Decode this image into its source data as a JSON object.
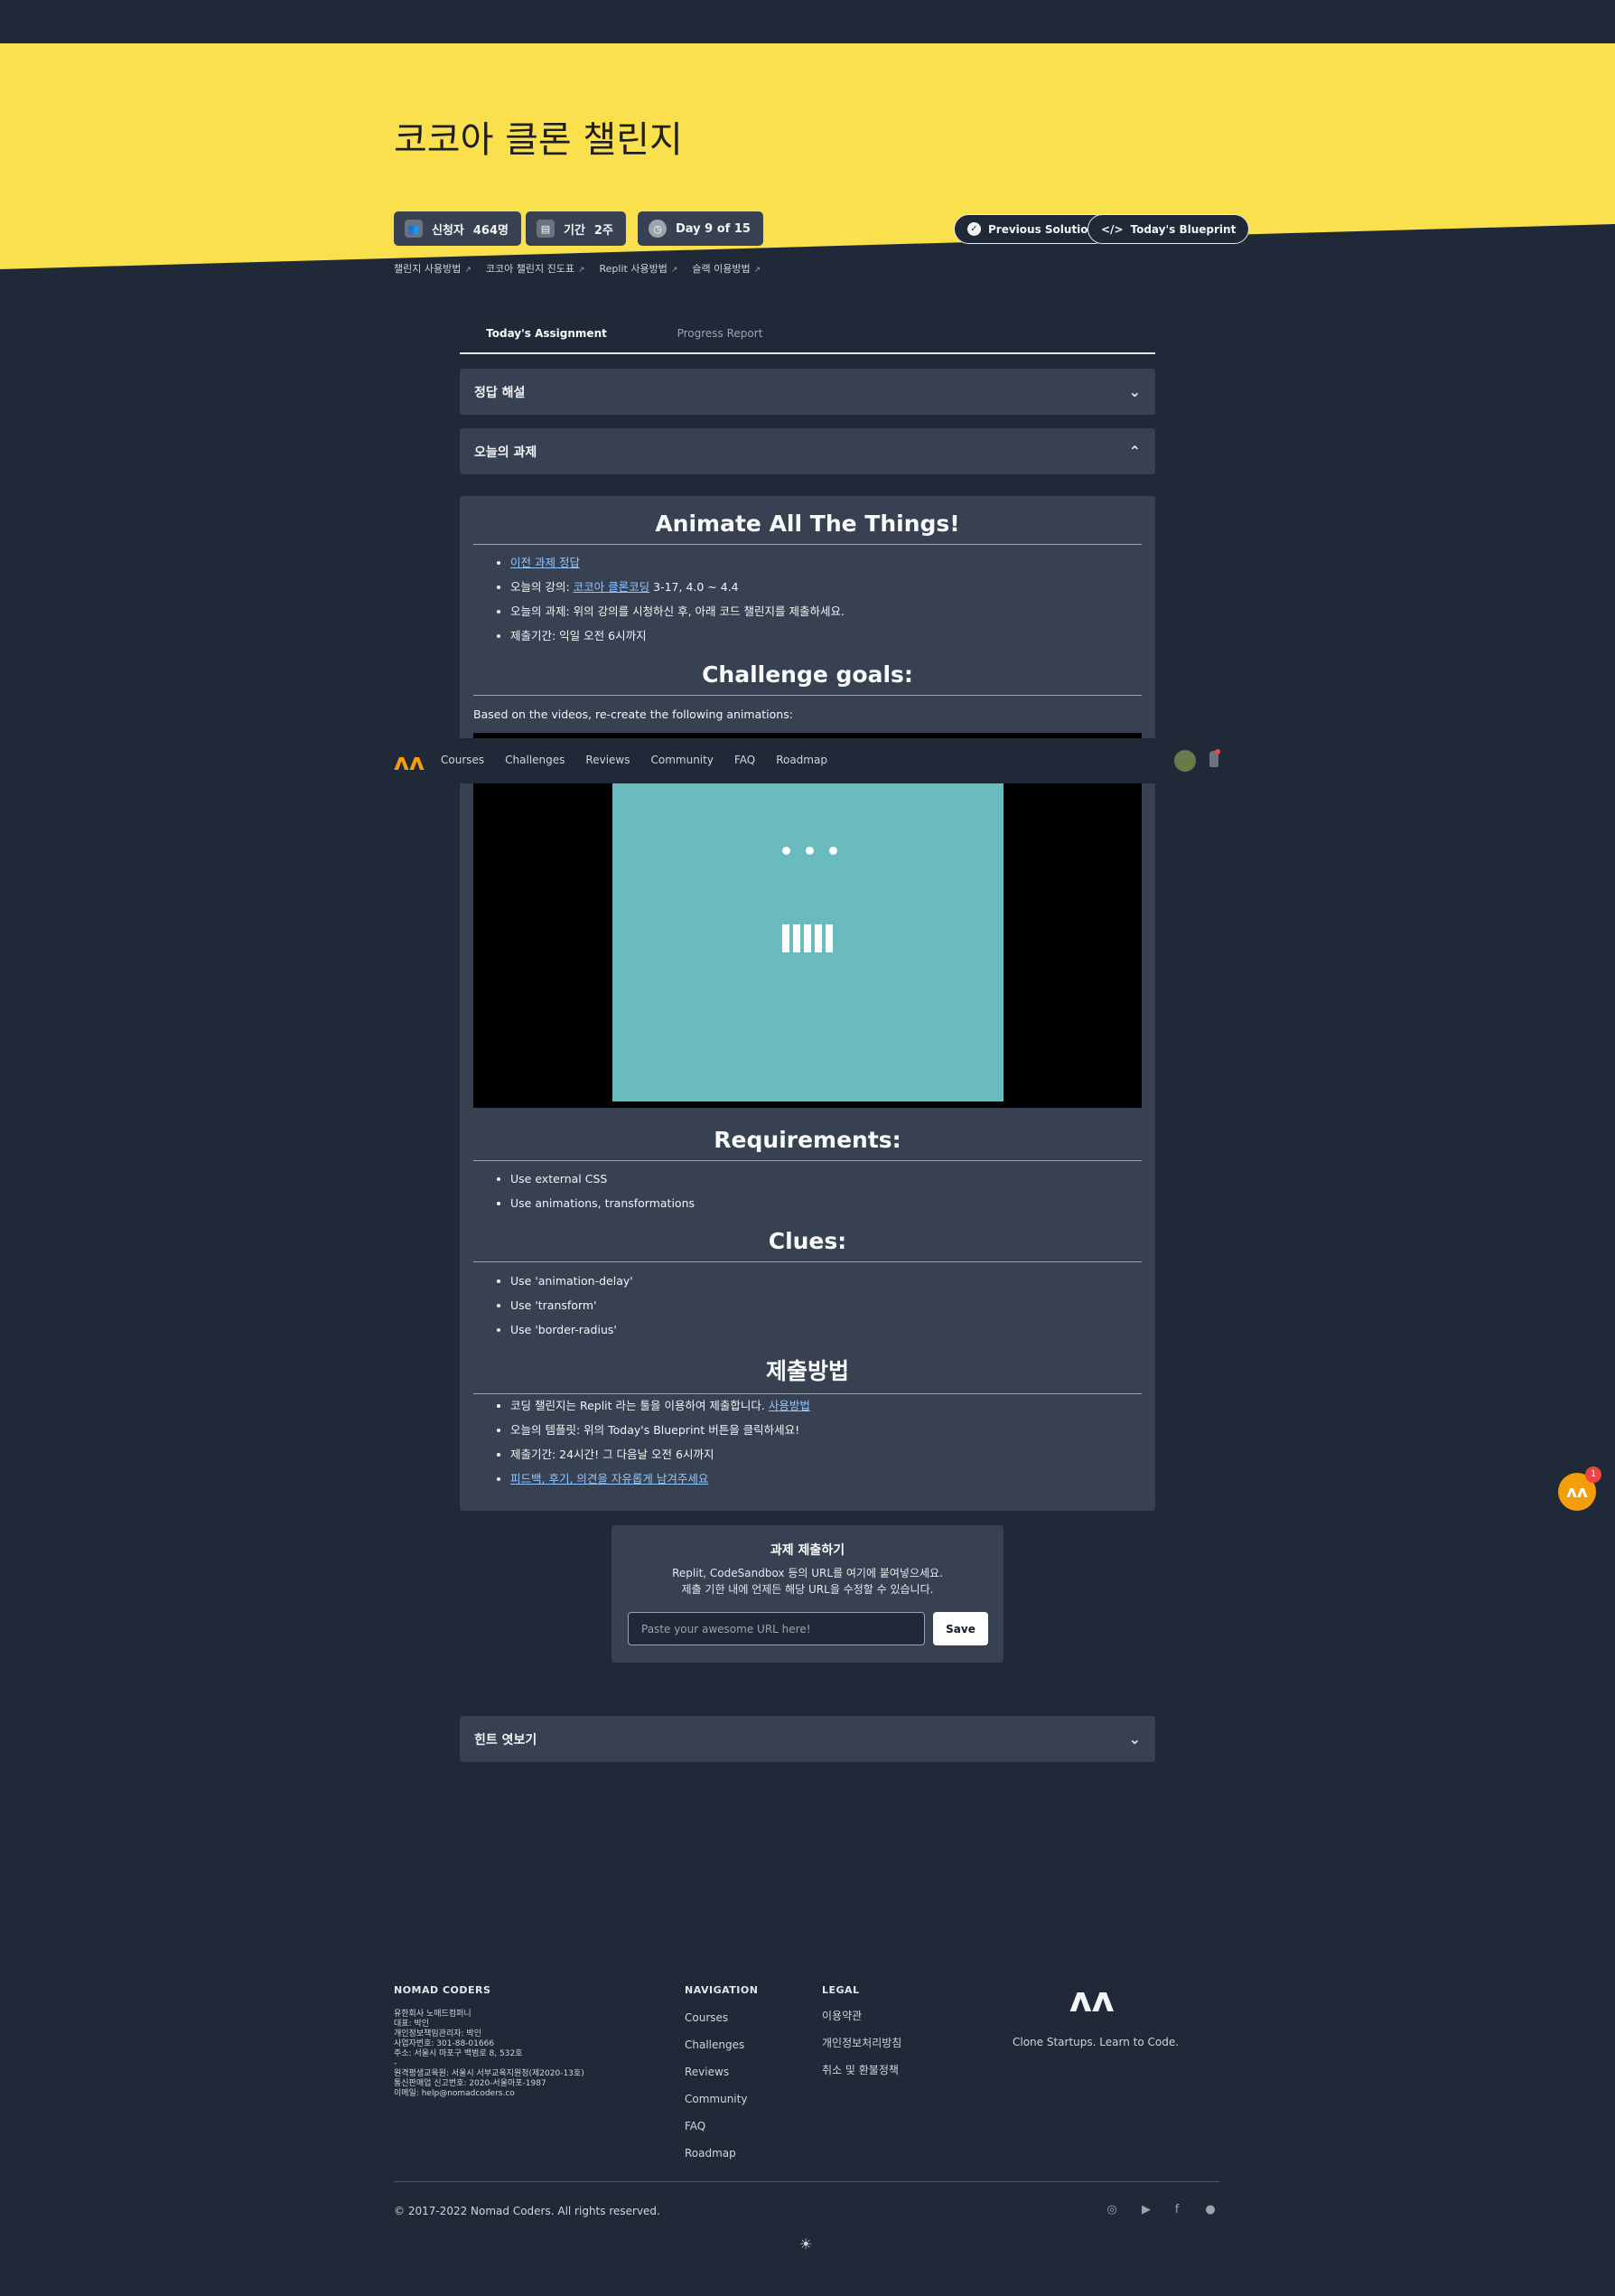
{
  "hero": {
    "title": "코코아 클론 챌린지",
    "stats": [
      {
        "label": "신청자",
        "value": "464명",
        "icon": "users-icon"
      },
      {
        "label": "기간",
        "value": "2주",
        "icon": "calendar-icon"
      },
      {
        "label": "Day 9 of 15",
        "icon": "clock-icon"
      }
    ],
    "buttons": {
      "previous_solution": "Previous Solution",
      "todays_blueprint": "Today's Blueprint"
    },
    "links": [
      "챌린지 사용방법",
      "코코아 챌린지 진도표",
      "Replit 사용방법",
      "슬랙 이용방법"
    ]
  },
  "tabs": [
    "Today's Assignment",
    "Progress Report"
  ],
  "accordions": {
    "answer": "정답 해설",
    "today": "오늘의 과제",
    "hint": "힌트 엿보기"
  },
  "content": {
    "h_animate": "Animate All The Things!",
    "animate_items": {
      "prev_link": "이전 과제 정답",
      "lecture_prefix": "오늘의 강의: ",
      "lecture_link": "코코아 클론코딩",
      "lecture_suffix": " 3-17, 4.0 ~ 4.4",
      "task": "오늘의 과제: 위의 강의를 시청하신 후, 아래 코드 챌린지를 제출하세요.",
      "deadline": "제출기간: 익일 오전 6시까지"
    },
    "h_goals": "Challenge goals:",
    "goals_desc": "Based on the videos, re-create the following animations:",
    "h_requirements": "Requirements:",
    "requirements": [
      "Use external CSS",
      "Use animations, transformations"
    ],
    "h_clues": "Clues:",
    "clues": [
      "Use 'animation-delay'",
      "Use 'transform'",
      "Use 'border-radius'"
    ],
    "h_submit": "제출방법",
    "submit_items": {
      "replit_prefix": "코딩 챌린지는 Replit 라는 툴을 이용하여 제출합니다. ",
      "replit_link": "사용방법",
      "template": "오늘의 템플릿: 위의 Today's Blueprint 버튼을 클릭하세요!",
      "deadline": "제출기간: 24시간! 그 다음날 오전 6시까지",
      "feedback_link": "피드백, 후기, 의견을 자유롭게 남겨주세요"
    }
  },
  "navbar": {
    "logo": "ʌʌ",
    "links": [
      "Courses",
      "Challenges",
      "Reviews",
      "Community",
      "FAQ",
      "Roadmap"
    ]
  },
  "submit": {
    "title": "과제 제출하기",
    "desc1": "Replit, CodeSandbox 등의 URL를 여기에 붙여넣으세요.",
    "desc2": "제출 기한 내에 언제든 해당 URL을 수정할 수 있습니다.",
    "placeholder": "Paste your awesome URL here!",
    "save": "Save"
  },
  "fab": {
    "badge": "1"
  },
  "footer": {
    "company_head": "NOMAD CODERS",
    "company_lines": [
      "유한회사 노매드컴퍼니",
      "대표: 박인",
      "개인정보책임관리자: 박인",
      "사업자번호: 301-88-01666",
      "주소: 서울시 마포구 백범로 8, 532호",
      "-",
      "원격평생교육원: 서울시 서부교육지원청(제2020-13호)",
      "통신판매업 신고번호: 2020-서울마포-1987",
      "이메일: help@nomadcoders.co"
    ],
    "nav_head": "NAVIGATION",
    "nav_items": [
      "Courses",
      "Challenges",
      "Reviews",
      "Community",
      "FAQ",
      "Roadmap"
    ],
    "legal_head": "LEGAL",
    "legal_items": [
      "이용약관",
      "개인정보처리방침",
      "취소 및 환불정책"
    ],
    "tagline": "Clone Startups. Learn to Code.",
    "copyright": "© 2017-2022 Nomad Coders. All rights reserved."
  },
  "colors": {
    "brand_yellow": "#fbe04d",
    "bg": "#1f2937",
    "card": "#374151",
    "accent": "#f59e0b",
    "link": "#93c5fd"
  }
}
